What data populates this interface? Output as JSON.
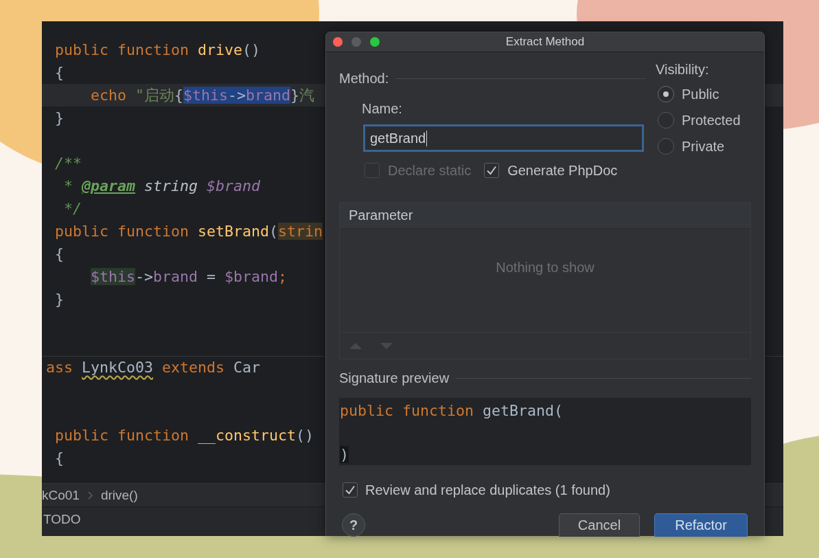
{
  "editor": {
    "lines": [
      {
        "kind": "code",
        "current": false,
        "tokens": [
          {
            "text": " public ",
            "kind": "keyword"
          },
          {
            "text": "function ",
            "kind": "keyword"
          },
          {
            "text": "drive",
            "kind": "function"
          },
          {
            "text": "()",
            "kind": "plain"
          }
        ]
      },
      {
        "kind": "code",
        "current": false,
        "tokens": [
          {
            "text": " {",
            "kind": "plain"
          }
        ]
      },
      {
        "kind": "code",
        "current": true,
        "tokens": [
          {
            "text": "     echo ",
            "kind": "keyword"
          },
          {
            "text": "\"启动",
            "kind": "string"
          },
          {
            "text": "{",
            "kind": "plain"
          },
          {
            "kind": "selection",
            "children": [
              {
                "text": "$this",
                "kind": "variable"
              },
              {
                "text": "->",
                "kind": "plain"
              },
              {
                "text": "brand",
                "kind": "variable"
              }
            ]
          },
          {
            "text": "}",
            "kind": "plain"
          },
          {
            "text": "汽",
            "kind": "string"
          }
        ]
      },
      {
        "kind": "code",
        "current": false,
        "tokens": [
          {
            "text": " }",
            "kind": "plain"
          }
        ]
      },
      {
        "kind": "blank"
      },
      {
        "kind": "code",
        "current": false,
        "tokens": [
          {
            "text": " /**",
            "kind": "doc"
          }
        ]
      },
      {
        "kind": "code",
        "current": false,
        "tokens": [
          {
            "text": "  * ",
            "kind": "doc"
          },
          {
            "text": "@param",
            "kind": "doctag"
          },
          {
            "text": " string ",
            "kind": "doctype"
          },
          {
            "text": "$brand",
            "kind": "docvar"
          }
        ]
      },
      {
        "kind": "code",
        "current": false,
        "tokens": [
          {
            "text": "  */",
            "kind": "doc"
          }
        ]
      },
      {
        "kind": "code",
        "current": false,
        "tokens": [
          {
            "text": " public ",
            "kind": "keyword"
          },
          {
            "text": "function ",
            "kind": "keyword"
          },
          {
            "text": "setBrand",
            "kind": "function"
          },
          {
            "text": "(",
            "kind": "plain"
          },
          {
            "kind": "usage",
            "children": [
              {
                "text": "strin",
                "kind": "keyword"
              }
            ]
          }
        ]
      },
      {
        "kind": "code",
        "current": false,
        "tokens": [
          {
            "text": " {",
            "kind": "plain"
          }
        ]
      },
      {
        "kind": "code",
        "current": false,
        "tokens": [
          {
            "kind": "write",
            "children": [
              {
                "text": "     $this",
                "kind": "variable"
              }
            ]
          },
          {
            "text": "->",
            "kind": "plain"
          },
          {
            "text": "brand",
            "kind": "variable"
          },
          {
            "text": " = ",
            "kind": "plain"
          },
          {
            "text": "$brand",
            "kind": "variable"
          },
          {
            "text": ";",
            "kind": "keyword"
          }
        ]
      },
      {
        "kind": "code",
        "current": false,
        "tokens": [
          {
            "text": " }",
            "kind": "plain"
          }
        ]
      },
      {
        "kind": "blank"
      },
      {
        "kind": "blank"
      },
      {
        "kind": "separator"
      },
      {
        "kind": "code",
        "current": false,
        "tokens": [
          {
            "text": "ass ",
            "kind": "keyword"
          },
          {
            "kind": "warning",
            "children": [
              {
                "text": "LynkCo03",
                "kind": "plain"
              }
            ]
          },
          {
            "text": " extends ",
            "kind": "keyword"
          },
          {
            "text": "Car",
            "kind": "plain"
          }
        ]
      },
      {
        "kind": "blank"
      },
      {
        "kind": "blank"
      },
      {
        "kind": "code",
        "current": false,
        "tokens": [
          {
            "text": " public ",
            "kind": "keyword"
          },
          {
            "text": "function ",
            "kind": "keyword"
          },
          {
            "text": "__construct",
            "kind": "function"
          },
          {
            "text": "()",
            "kind": "plain"
          }
        ]
      },
      {
        "kind": "code",
        "current": false,
        "tokens": [
          {
            "text": " {",
            "kind": "plain"
          }
        ]
      }
    ]
  },
  "breadcrumbs": {
    "items": [
      "kCo01",
      "drive()"
    ]
  },
  "tool_window_bar": {
    "tabs": [
      "TODO"
    ]
  },
  "dialog": {
    "title": "Extract Method",
    "window_buttons": [
      {
        "kind": "close",
        "disabled": false
      },
      {
        "kind": "minimize",
        "disabled": true
      },
      {
        "kind": "zoom",
        "disabled": false
      }
    ],
    "method_section": {
      "label": "Method:"
    },
    "name_field": {
      "label": "Name:",
      "value": "getBrand",
      "focused": true
    },
    "options": [
      {
        "label": "Declare static",
        "checked": false,
        "disabled": true
      },
      {
        "label": "Generate PhpDoc",
        "checked": true,
        "disabled": false
      }
    ],
    "visibility": {
      "label": "Visibility:",
      "options": [
        {
          "label": "Public",
          "selected": true
        },
        {
          "label": "Protected",
          "selected": false
        },
        {
          "label": "Private",
          "selected": false
        }
      ]
    },
    "parameter_table": {
      "columns": [
        "Parameter"
      ],
      "empty_text": "Nothing to show",
      "toolbar": [
        {
          "kind": "up",
          "disabled": true
        },
        {
          "kind": "down",
          "disabled": true
        }
      ]
    },
    "signature_preview": {
      "label": "Signature preview",
      "lines": [
        {
          "kind": "code",
          "tokens": [
            {
              "text": "public ",
              "kind": "keyword"
            },
            {
              "text": "function ",
              "kind": "keyword"
            },
            {
              "text": "getBrand(",
              "kind": "plain"
            }
          ]
        },
        {
          "kind": "blank"
        },
        {
          "kind": "code",
          "tokens": [
            {
              "kind": "brace",
              "children": [
                {
                  "text": ")",
                  "kind": "plain"
                }
              ]
            }
          ]
        }
      ]
    },
    "duplicates": {
      "label": "Review and replace duplicates (1 found)",
      "checked": true
    },
    "buttons": [
      {
        "kind": "help",
        "label": "?"
      },
      {
        "kind": "cancel",
        "label": "Cancel"
      },
      {
        "kind": "confirm",
        "label": "Refactor"
      }
    ]
  }
}
